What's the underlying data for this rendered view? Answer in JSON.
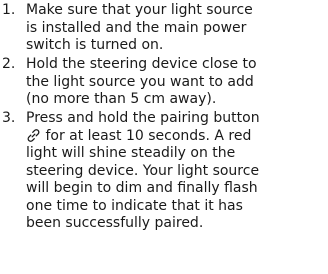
{
  "steps": [
    {
      "number": "1.",
      "lines": [
        "Make sure that your light source",
        "is installed and the main power",
        "switch is turned on."
      ]
    },
    {
      "number": "2.",
      "lines": [
        "Hold the steering device close to",
        "the light source you want to add",
        "(no more than 5 cm away)."
      ]
    },
    {
      "number": "3.",
      "line1_before_icon": "Press and hold the pairing button",
      "icon": "link-icon",
      "line2_after_icon": " for at least 10 seconds. A red",
      "lines_rest": [
        "light will shine steadily on the",
        "steering device. Your light source",
        "will begin to dim and finally flash",
        "one time to indicate that it has",
        "been successfully paired."
      ]
    }
  ]
}
